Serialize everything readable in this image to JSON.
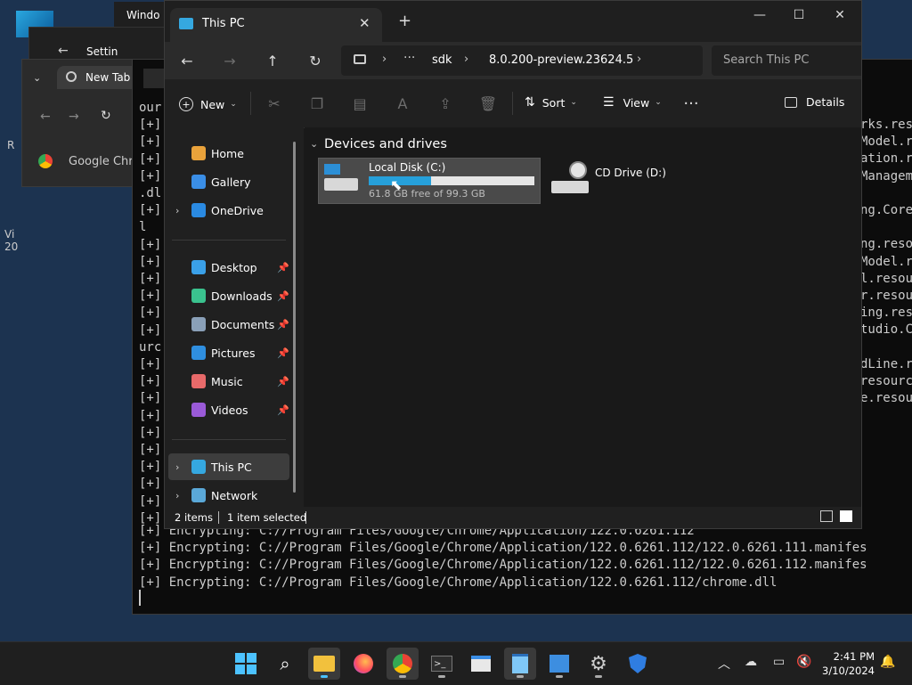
{
  "background": {
    "bg_window_title": "Windo",
    "settings_title": "Settin",
    "chrome_tab_title": "New Tab",
    "chrome_app_title": "Google Chro",
    "left_edge_text": [
      "R",
      "Vi",
      "20"
    ]
  },
  "terminal": {
    "lines_left": [
      "our",
      "[+]",
      "[+]",
      "[+]",
      "[+]",
      ".dl",
      "[+]",
      "l",
      "[+]",
      "[+]",
      "[+]",
      "[+]",
      "[+]",
      "[+]",
      "urc",
      "[+]",
      "[+]",
      "[+]",
      "[+]",
      "[+]",
      "[+]",
      "[+]",
      "[+]",
      "[+]",
      "[+]"
    ],
    "lines_right": [
      "rks.res",
      "Model.r",
      "ation.r",
      "Managem",
      "",
      "ng.Core",
      "",
      "ng.reso",
      "Model.r",
      "l.resou",
      "r.resou",
      "ing.res",
      "tudio.C",
      "",
      "dLine.r",
      "resourc",
      "e.resou"
    ],
    "bottom_lines": [
      "[+] Encrypting: C://Program Files/Google/Chrome/Application/122.0.6261.112",
      "[+] Encrypting: C://Program Files/Google/Chrome/Application/122.0.6261.112/122.0.6261.111.manifes",
      "[+] Encrypting: C://Program Files/Google/Chrome/Application/122.0.6261.112/122.0.6261.112.manifes",
      "[+] Encrypting: C://Program Files/Google/Chrome/Application/122.0.6261.112/chrome.dll"
    ]
  },
  "explorer": {
    "tab_title": "This PC",
    "new_tab_symbol": "+",
    "breadcrumb": [
      "sdk",
      "8.0.200-preview.23624.5"
    ],
    "search_placeholder": "Search This PC",
    "commands": {
      "new": "New",
      "sort": "Sort",
      "view": "View",
      "details": "Details"
    },
    "nav_items": [
      {
        "label": "Home",
        "icon": "home-icon"
      },
      {
        "label": "Gallery",
        "icon": "gallery-icon"
      },
      {
        "label": "OneDrive",
        "icon": "cloud-icon"
      },
      {
        "label": "Desktop",
        "icon": "desktop-icon"
      },
      {
        "label": "Downloads",
        "icon": "download-icon"
      },
      {
        "label": "Documents",
        "icon": "document-icon"
      },
      {
        "label": "Pictures",
        "icon": "pictures-icon"
      },
      {
        "label": "Music",
        "icon": "music-icon"
      },
      {
        "label": "Videos",
        "icon": "video-icon"
      },
      {
        "label": "This PC",
        "icon": "computer-icon"
      },
      {
        "label": "Network",
        "icon": "network-icon"
      }
    ],
    "section_title": "Devices and drives",
    "drives": [
      {
        "name": "Local Disk (C:)",
        "free_text": "61.8 GB free of 99.3 GB",
        "used_fraction": 0.378
      },
      {
        "name": "CD Drive (D:)"
      }
    ],
    "status": {
      "items": "2 items",
      "selected": "1 item selected"
    }
  },
  "taskbar": {
    "time": "2:41 PM",
    "date": "3/10/2024"
  },
  "colors": {
    "accent": "#26a0da",
    "selection": "#4a4a4a"
  }
}
